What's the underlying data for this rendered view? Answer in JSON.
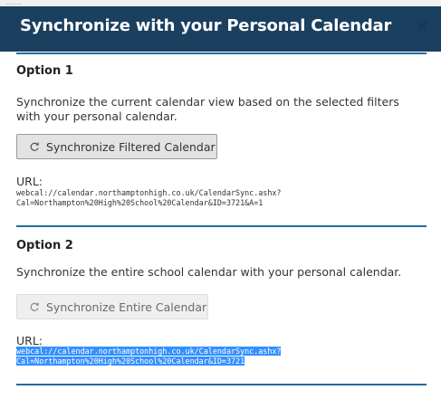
{
  "dialog": {
    "title": "Synchronize with your Personal Calendar",
    "close_symbol": "×"
  },
  "option1": {
    "heading": "Option 1",
    "description": "Synchronize the current calendar view based on the selected filters with your personal calendar.",
    "button_label": "Synchronize Filtered Calendar",
    "button_icon": "sync-icon",
    "url_label": "URL:",
    "url_line1": "webcal://calendar.northamptonhigh.co.uk/CalendarSync.ashx?",
    "url_line2": "Cal=Northampton%20High%20School%20Calendar&ID=3721&A=1"
  },
  "option2": {
    "heading": "Option 2",
    "description": "Synchronize the entire school calendar with your personal calendar.",
    "button_label": "Synchronize Entire Calendar",
    "button_icon": "sync-icon",
    "url_label": "URL:",
    "url_line1": "webcal://calendar.northamptonhigh.co.uk/CalendarSync.ashx?",
    "url_line2": "Cal=Northampton%20High%20School%20Calendar&ID=3721",
    "url_selected": true
  },
  "colors": {
    "header_bg": "#1a3f5f",
    "rule": "#1e6e9e",
    "selection": "#3390ff"
  }
}
